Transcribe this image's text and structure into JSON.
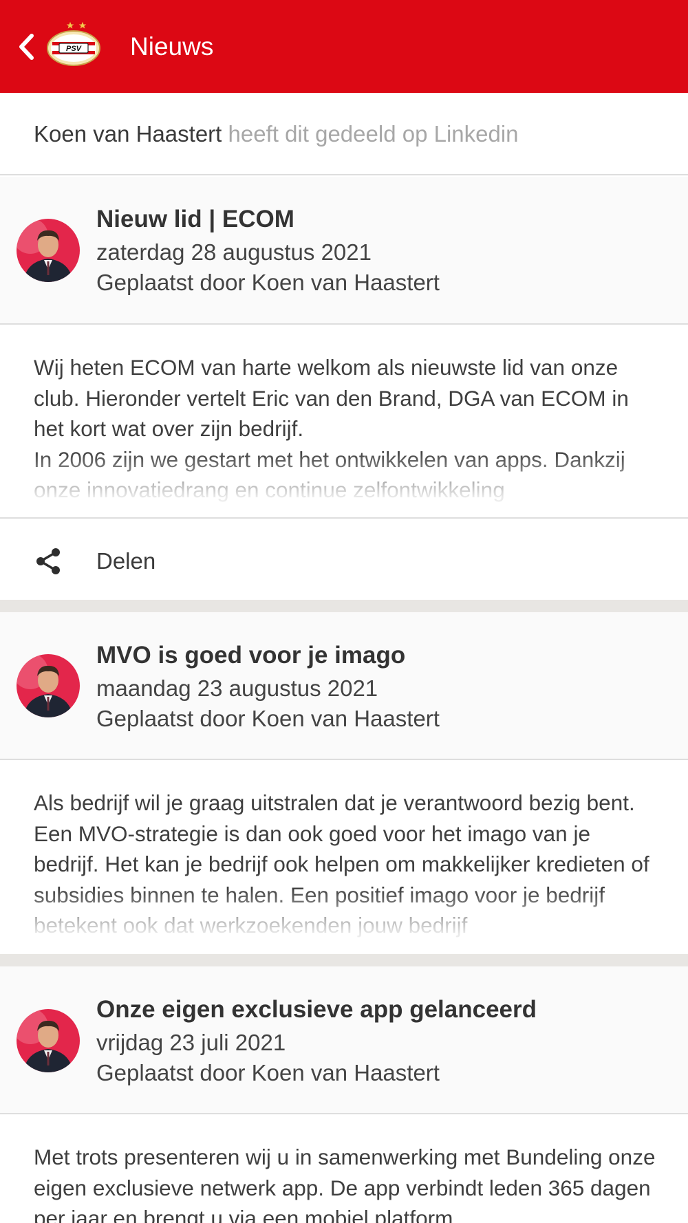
{
  "header": {
    "title": "Nieuws",
    "back_icon": "chevron-left-icon",
    "logo_text": "PSV",
    "background": "#dc0814"
  },
  "shared": {
    "name": "Koen van Haastert",
    "rest": " heeft dit gedeeld op Linkedin"
  },
  "posts": [
    {
      "title": "Nieuw lid | ECOM",
      "date": "zaterdag 28 augustus 2021",
      "author": "Geplaatst door Koen van Haastert",
      "body": "Wij heten ECOM van harte welkom als nieuwste lid van onze club. Hieronder vertelt Eric van den Brand, DGA van ECOM in het kort wat over zijn bedrijf.\nIn 2006 zijn we gestart met het ontwikkelen van apps. Dankzij onze innovatiedrang en continue zelfontwikkeling",
      "share_label": "Delen",
      "share_icon": "share-icon"
    },
    {
      "title": "MVO is goed voor je imago",
      "date": "maandag 23 augustus 2021",
      "author": "Geplaatst door Koen van Haastert",
      "body": "Als bedrijf wil je graag uitstralen dat je verantwoord bezig bent. Een MVO-strategie is dan ook goed voor het imago van je bedrijf. Het kan je bedrijf ook helpen om makkelijker kredieten of subsidies binnen te halen. Een positief imago voor je bedrijf betekent ook dat werkzoekenden jouw bedrijf"
    },
    {
      "title": "Onze eigen exclusieve app gelanceerd",
      "date": "vrijdag 23 juli 2021",
      "author": "Geplaatst door Koen van Haastert",
      "body": "Met trots presenteren wij u in samenwerking met Bundeling onze eigen exclusieve netwerk app. De app verbindt leden 365 dagen per jaar en brengt u via een mobiel platform"
    }
  ]
}
